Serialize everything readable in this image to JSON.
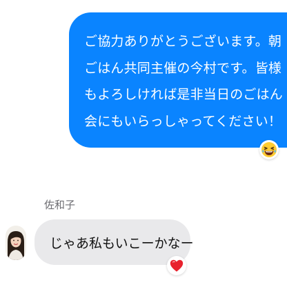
{
  "thread": {
    "outgoing_message": {
      "lines": [
        "ご協力ありがとうございます。朝",
        "ごはん共同主催の今村です。皆様",
        "もよろしければ是非当日のごはん",
        "会にもいらっしゃってください！"
      ],
      "bubble_color": "#0a84ff",
      "text_color": "#ffffff",
      "reaction_icon": "laughing-face-icon"
    },
    "incoming_message": {
      "sender_name": "佐和子",
      "text": "じゃあ私もいこーかなー",
      "bubble_color": "#e9e9eb",
      "reaction_icon": "heart-icon"
    }
  }
}
